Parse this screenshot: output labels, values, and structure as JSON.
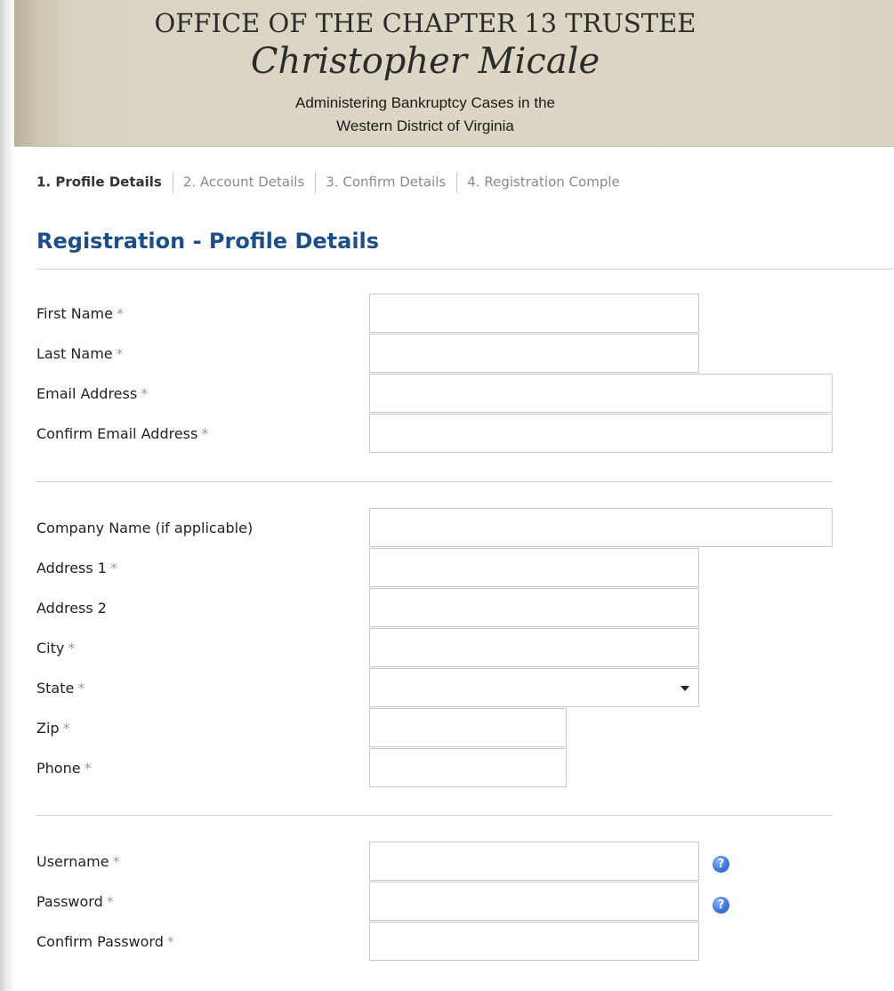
{
  "header": {
    "title": "OFFICE OF THE CHAPTER 13 TRUSTEE",
    "name": "Christopher Micale",
    "subtitle_line1": "Administering Bankruptcy Cases in the",
    "subtitle_line2": "Western District of Virginia"
  },
  "steps": [
    {
      "label": "1. Profile Details",
      "active": true
    },
    {
      "label": "2. Account Details",
      "active": false
    },
    {
      "label": "3. Confirm Details",
      "active": false
    },
    {
      "label": "4. Registration Comple",
      "active": false
    }
  ],
  "page_title": "Registration - Profile Details",
  "required_marker": "*",
  "form": {
    "first_name": {
      "label": "First Name",
      "required": true,
      "value": ""
    },
    "last_name": {
      "label": "Last Name",
      "required": true,
      "value": ""
    },
    "email": {
      "label": "Email Address",
      "required": true,
      "value": ""
    },
    "confirm_email": {
      "label": "Confirm Email Address",
      "required": true,
      "value": ""
    },
    "company": {
      "label": "Company Name (if applicable)",
      "required": false,
      "value": ""
    },
    "address1": {
      "label": "Address 1",
      "required": true,
      "value": ""
    },
    "address2": {
      "label": "Address 2",
      "required": false,
      "value": ""
    },
    "city": {
      "label": "City",
      "required": true,
      "value": ""
    },
    "state": {
      "label": "State",
      "required": true,
      "selected": ""
    },
    "zip": {
      "label": "Zip",
      "required": true,
      "value": ""
    },
    "phone": {
      "label": "Phone",
      "required": true,
      "value": ""
    },
    "username": {
      "label": "Username",
      "required": true,
      "value": ""
    },
    "password": {
      "label": "Password",
      "required": true,
      "value": ""
    },
    "confirm_password": {
      "label": "Confirm Password",
      "required": true,
      "value": ""
    }
  },
  "help_icon": {
    "glyph": "?",
    "icon": "question-circle-icon",
    "color": "#3d78d8"
  },
  "colors": {
    "title": "#1d4f86",
    "header_bg": "#dcd6c5"
  }
}
